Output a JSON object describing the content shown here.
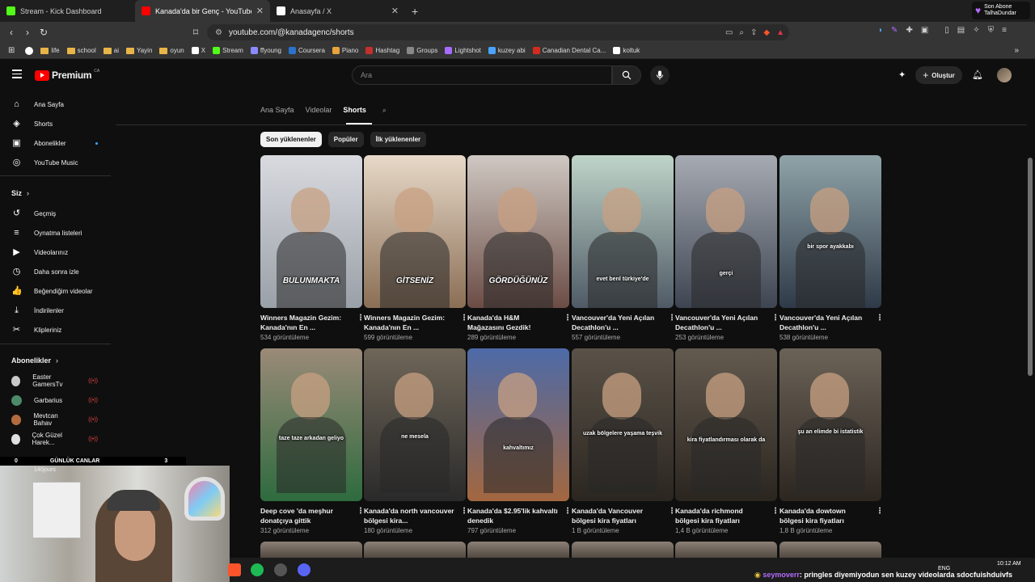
{
  "browser": {
    "tabs": [
      {
        "title": "Stream - Kick Dashboard",
        "fav_color": "#53fc18"
      },
      {
        "title": "Kanada'da bir Genç - YouTube",
        "fav_color": "#ff0000",
        "active": true
      },
      {
        "title": "Anasayfa / X",
        "fav_color": "#ffffff"
      }
    ],
    "url": "youtube.com/@kanadagenc/shorts",
    "subscriber_badge": {
      "line1": "Son Abone",
      "line2": "TalhaDundar"
    },
    "bookmarks": [
      {
        "label": "life",
        "type": "folder"
      },
      {
        "label": "school",
        "type": "folder"
      },
      {
        "label": "ai",
        "type": "folder"
      },
      {
        "label": "Yayin",
        "type": "folder"
      },
      {
        "label": "oyun",
        "type": "folder"
      },
      {
        "label": "X",
        "type": "site",
        "color": "#ffffff"
      },
      {
        "label": "Stream",
        "type": "site",
        "color": "#53fc18"
      },
      {
        "label": "ffyoung",
        "type": "site",
        "color": "#8a8aff"
      },
      {
        "label": "Coursera",
        "type": "site",
        "color": "#2a73cc"
      },
      {
        "label": "Piano",
        "type": "site",
        "color": "#e8a33d"
      },
      {
        "label": "Hashtag",
        "type": "site",
        "color": "#c4302b"
      },
      {
        "label": "Groups",
        "type": "site",
        "color": "#888888"
      },
      {
        "label": "Lightshot",
        "type": "site",
        "color": "#a66bff"
      },
      {
        "label": "kuzey abi",
        "type": "site",
        "color": "#4aa3ff"
      },
      {
        "label": "Canadian Dental Ca...",
        "type": "site",
        "color": "#d52b1e"
      },
      {
        "label": "koltuk",
        "type": "site",
        "color": "#ffffff"
      }
    ]
  },
  "youtube": {
    "logo_text": "Premium",
    "logo_region": "CA",
    "search_placeholder": "Ara",
    "create_label": "Oluştur",
    "sidebar": {
      "main": [
        {
          "label": "Ana Sayfa",
          "icon": "home-icon",
          "glyph": "⌂"
        },
        {
          "label": "Shorts",
          "icon": "shorts-icon",
          "glyph": "◈"
        },
        {
          "label": "Abonelikler",
          "icon": "subscriptions-icon",
          "glyph": "▣"
        },
        {
          "label": "YouTube Music",
          "icon": "music-icon",
          "glyph": "◎"
        }
      ],
      "you_heading": "Siz",
      "you": [
        {
          "label": "Geçmiş",
          "icon": "history-icon",
          "glyph": "↺"
        },
        {
          "label": "Oynatma listeleri",
          "icon": "playlist-icon",
          "glyph": "≡"
        },
        {
          "label": "Videolarınız",
          "icon": "your-videos-icon",
          "glyph": "▶"
        },
        {
          "label": "Daha sonra izle",
          "icon": "watch-later-icon",
          "glyph": "◷"
        },
        {
          "label": "Beğendiğim videolar",
          "icon": "like-icon",
          "glyph": "👍"
        },
        {
          "label": "İndirilenler",
          "icon": "download-icon",
          "glyph": "⤓"
        },
        {
          "label": "Klipleriniz",
          "icon": "clips-icon",
          "glyph": "✂"
        }
      ],
      "subs_heading": "Abonelikler",
      "subscriptions": [
        {
          "label": "Easter GamersTv",
          "color": "#c9c9c9"
        },
        {
          "label": "Garbarius",
          "color": "#4c8a6a"
        },
        {
          "label": "Mevtcan Bahav",
          "color": "#b36b3e"
        },
        {
          "label": "Çok Güzel Harek...",
          "color": "#e0e0e0"
        }
      ]
    },
    "channel_tabs": [
      "Ana Sayfa",
      "Videolar",
      "Shorts"
    ],
    "filters": [
      "Son yüklenenler",
      "Popüler",
      "İlk yüklenenler"
    ],
    "shorts": [
      {
        "title": "Winners Magazin Gezim: Kanada'nın En ...",
        "views": "534 görüntüleme",
        "caption": "BULUNMAKTA",
        "bg": [
          "#d8dadf",
          "#9aa0a8"
        ]
      },
      {
        "title": "Winners Magazin Gezim: Kanada'nın En ...",
        "views": "599 görüntüleme",
        "caption": "GİTSENİZ",
        "bg": [
          "#e7d9c8",
          "#8b6e55"
        ]
      },
      {
        "title": "Kanada'da H&M Mağazasını Gezdik!",
        "views": "289 görüntüleme",
        "caption": "GÖRDÜĞÜNÜZ",
        "bg": [
          "#cfc8c2",
          "#6b4c45"
        ]
      },
      {
        "title": "Vancouver'da Yeni Açılan Decathlon'u ...",
        "views": "557 görüntüleme",
        "caption": "evet benl türkiye'de",
        "bg": [
          "#bfd4c8",
          "#4f5a66"
        ]
      },
      {
        "title": "Vancouver'da Yeni Açılan Decathlon'u ...",
        "views": "253 görüntüleme",
        "caption": "gerçi",
        "bg": [
          "#a6aab2",
          "#3e4552"
        ]
      },
      {
        "title": "Vancouver'da Yeni Açılan Decathlon'u ...",
        "views": "538 görüntüleme",
        "caption": "bir spor ayakkabı",
        "bg": [
          "#8fa3a8",
          "#2f3a48"
        ]
      },
      {
        "title": "Deep cove 'da meşhur donatçıya gittik",
        "views": "312 görüntüleme",
        "caption": "taze taze arkadan geliyo",
        "bg": [
          "#9a8a78",
          "#2e6b3e"
        ]
      },
      {
        "title": "Kanada'da north vancouver bölgesi kira...",
        "views": "180 görüntüleme",
        "caption": "ne mesela",
        "bg": [
          "#6f6658",
          "#2a2a2a"
        ]
      },
      {
        "title": "Kanada'da $2.95'lik kahvaltı denedik",
        "views": "797 görüntüleme",
        "caption": "kahvaltımız",
        "bg": [
          "#4d6aa8",
          "#a3673f"
        ]
      },
      {
        "title": "Kanada'da Vancouver bölgesi kira fiyatları",
        "views": "1 B görüntüleme",
        "caption": "uzak bölgelere yaşama teşvik",
        "bg": [
          "#5a5248",
          "#2b2620"
        ]
      },
      {
        "title": "Kanada'da richmond bölgesi kira fiyatları",
        "views": "1,4 B görüntüleme",
        "caption": "kira fiyatlandırması olarak da",
        "bg": [
          "#635a4f",
          "#2a251f"
        ]
      },
      {
        "title": "Kanada'da dowtown bölgesi kira fiyatları",
        "views": "1,8 B görüntüleme",
        "caption": "şu an elimde bi istatistik",
        "bg": [
          "#6b6257",
          "#2c2620"
        ]
      }
    ]
  },
  "stream": {
    "bar_left": "0",
    "bar_title": "GÜNLÜK CANLAR",
    "bar_right": "3",
    "bar_sub": "140jours",
    "chat_user": "seymoverr",
    "chat_message": ": pringles diyemiyodun sen kuzey videolarda sdocfuishduivfs"
  },
  "system": {
    "lang": "ENG",
    "time": "10:12 AM"
  }
}
